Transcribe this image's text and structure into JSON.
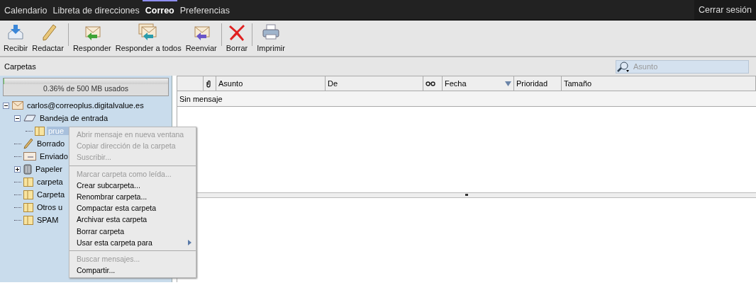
{
  "nav": {
    "tabs": [
      {
        "label": "Calendario",
        "selected": false
      },
      {
        "label": "Libreta de direcciones",
        "selected": false
      },
      {
        "label": "Correo",
        "selected": true
      },
      {
        "label": "Preferencias",
        "selected": false
      }
    ],
    "logout": "Cerrar sesión"
  },
  "toolbar": [
    {
      "kind": "receive",
      "label": "Recibir"
    },
    {
      "kind": "compose",
      "label": "Redactar"
    },
    {
      "kind": "separator"
    },
    {
      "kind": "reply",
      "label": "Responder"
    },
    {
      "kind": "reply-all",
      "label": "Responder a todos"
    },
    {
      "kind": "forward",
      "label": "Reenviar"
    },
    {
      "kind": "separator"
    },
    {
      "kind": "delete",
      "label": "Borrar"
    },
    {
      "kind": "separator"
    },
    {
      "kind": "print",
      "label": "Imprimir"
    }
  ],
  "folders_title": "Carpetas",
  "search": {
    "placeholder": "Asunto"
  },
  "quota": {
    "level": 0.0036,
    "label": "0.36% de 500 MB usados"
  },
  "tree": [
    {
      "kind": "account",
      "label": "carlos@correoplus.digitalvalue.es",
      "expanded": true,
      "selected": false,
      "children": [
        {
          "kind": "inbox",
          "label": "Bandeja de entrada",
          "expanded": true,
          "selected": false,
          "children": [
            {
              "kind": "folder",
              "label": "prue",
              "selected": true
            }
          ]
        },
        {
          "kind": "drafts",
          "label": "Borrado",
          "selected": false
        },
        {
          "kind": "sent",
          "label": "Enviado",
          "selected": false
        },
        {
          "kind": "trash",
          "label": "Papeler",
          "expanded": false,
          "selected": false
        },
        {
          "kind": "folder",
          "label": "carpeta",
          "selected": false
        },
        {
          "kind": "folder",
          "label": "Carpeta",
          "selected": false
        },
        {
          "kind": "folder",
          "label": "Otros u",
          "selected": false
        },
        {
          "kind": "folder",
          "label": "SPAM",
          "selected": false
        }
      ]
    }
  ],
  "columns": [
    {
      "kind": "blank"
    },
    {
      "kind": "attachment"
    },
    {
      "kind": "text",
      "label": "Asunto"
    },
    {
      "kind": "text",
      "label": "De"
    },
    {
      "kind": "glasses"
    },
    {
      "kind": "text",
      "label": "Fecha",
      "sorted": true
    },
    {
      "kind": "text",
      "label": "Prioridad"
    },
    {
      "kind": "text",
      "label": "Tamaño"
    }
  ],
  "empty_message": "Sin mensaje",
  "context_menu": [
    {
      "kind": "item",
      "label": "Abrir mensaje en nueva ventana",
      "disabled": true
    },
    {
      "kind": "item",
      "label": "Copiar dirección de la carpeta",
      "disabled": true
    },
    {
      "kind": "item",
      "label": "Suscribir...",
      "disabled": true
    },
    {
      "kind": "separator"
    },
    {
      "kind": "item",
      "label": "Marcar carpeta como leída...",
      "disabled": true
    },
    {
      "kind": "item",
      "label": "Crear subcarpeta...",
      "disabled": false
    },
    {
      "kind": "item",
      "label": "Renombrar carpeta...",
      "disabled": false
    },
    {
      "kind": "item",
      "label": "Compactar esta carpeta",
      "disabled": false
    },
    {
      "kind": "item",
      "label": "Archivar esta carpeta",
      "disabled": false
    },
    {
      "kind": "item",
      "label": "Borrar carpeta",
      "disabled": false
    },
    {
      "kind": "submenu",
      "label": "Usar esta carpeta para",
      "disabled": false
    },
    {
      "kind": "separator"
    },
    {
      "kind": "item",
      "label": "Buscar mensajes...",
      "disabled": true
    },
    {
      "kind": "item",
      "label": "Compartir...",
      "disabled": false
    }
  ]
}
